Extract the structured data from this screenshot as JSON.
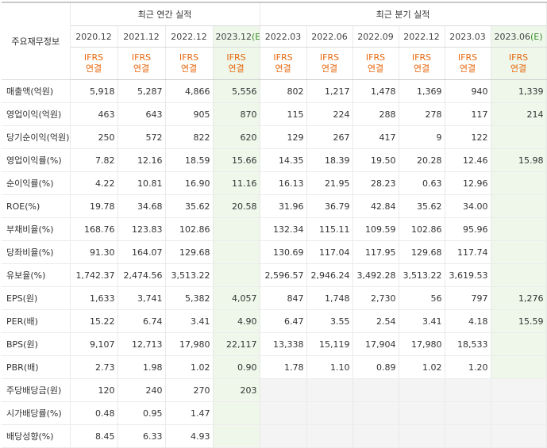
{
  "header": {
    "corner_label": "주요재무정보",
    "annual_group": "최근 연간 실적",
    "quarterly_group": "최근 분기 실적",
    "periods": [
      {
        "label": "2020.12",
        "est": false
      },
      {
        "label": "2021.12",
        "est": false
      },
      {
        "label": "2022.12",
        "est": false
      },
      {
        "label": "2023.12",
        "est": true,
        "est_mark": "(E)"
      },
      {
        "label": "2022.03",
        "est": false
      },
      {
        "label": "2022.06",
        "est": false
      },
      {
        "label": "2022.09",
        "est": false
      },
      {
        "label": "2022.12",
        "est": false
      },
      {
        "label": "2023.03",
        "est": false
      },
      {
        "label": "2023.06",
        "est": true,
        "est_mark": "(E)"
      }
    ],
    "ifrs_line1": "IFRS",
    "ifrs_line2": "연결"
  },
  "rows": [
    {
      "label": "매출액(억원)",
      "group_start": false,
      "values": [
        "5,918",
        "5,287",
        "4,866",
        "5,556",
        "802",
        "1,217",
        "1,478",
        "1,369",
        "940",
        "1,339"
      ]
    },
    {
      "label": "영업이익(억원)",
      "group_start": false,
      "values": [
        "463",
        "643",
        "905",
        "870",
        "115",
        "224",
        "288",
        "278",
        "117",
        "214"
      ]
    },
    {
      "label": "당기순이익(억원)",
      "group_start": false,
      "values": [
        "250",
        "572",
        "822",
        "620",
        "129",
        "267",
        "417",
        "9",
        "122",
        ""
      ]
    },
    {
      "label": "영업이익률(%)",
      "group_start": true,
      "values": [
        "7.82",
        "12.16",
        "18.59",
        "15.66",
        "14.35",
        "18.39",
        "19.50",
        "20.28",
        "12.46",
        "15.98"
      ]
    },
    {
      "label": "순이익률(%)",
      "group_start": false,
      "values": [
        "4.22",
        "10.81",
        "16.90",
        "11.16",
        "16.13",
        "21.95",
        "28.23",
        "0.63",
        "12.96",
        ""
      ]
    },
    {
      "label": "ROE(%)",
      "group_start": false,
      "values": [
        "19.78",
        "34.68",
        "35.62",
        "20.58",
        "31.96",
        "36.79",
        "42.84",
        "35.62",
        "34.00",
        ""
      ]
    },
    {
      "label": "부채비율(%)",
      "group_start": true,
      "values": [
        "168.76",
        "123.83",
        "102.86",
        "",
        "132.34",
        "115.11",
        "109.59",
        "102.86",
        "95.96",
        ""
      ]
    },
    {
      "label": "당좌비율(%)",
      "group_start": false,
      "values": [
        "91.30",
        "164.07",
        "129.68",
        "",
        "130.69",
        "117.04",
        "117.95",
        "129.68",
        "117.74",
        ""
      ]
    },
    {
      "label": "유보율(%)",
      "group_start": false,
      "values": [
        "1,742.37",
        "2,474.56",
        "3,513.22",
        "",
        "2,596.57",
        "2,946.24",
        "3,492.28",
        "3,513.22",
        "3,619.53",
        ""
      ]
    },
    {
      "label": "EPS(원)",
      "group_start": true,
      "values": [
        "1,633",
        "3,741",
        "5,382",
        "4,057",
        "847",
        "1,748",
        "2,730",
        "56",
        "797",
        "1,276"
      ]
    },
    {
      "label": "PER(배)",
      "group_start": false,
      "values": [
        "15.22",
        "6.74",
        "3.41",
        "4.90",
        "6.47",
        "3.55",
        "2.54",
        "3.41",
        "4.18",
        "15.59"
      ]
    },
    {
      "label": "BPS(원)",
      "group_start": false,
      "values": [
        "9,107",
        "12,713",
        "17,980",
        "22,117",
        "13,338",
        "15,119",
        "17,904",
        "17,980",
        "18,533",
        ""
      ]
    },
    {
      "label": "PBR(배)",
      "group_start": false,
      "values": [
        "2.73",
        "1.98",
        "1.02",
        "0.90",
        "1.78",
        "1.10",
        "0.89",
        "1.02",
        "1.20",
        ""
      ]
    },
    {
      "label": "주당배당금(원)",
      "group_start": true,
      "values": [
        "120",
        "240",
        "270",
        "203",
        "",
        "",
        "",
        "",
        "",
        ""
      ]
    },
    {
      "label": "시가배당률(%)",
      "group_start": false,
      "values": [
        "0.48",
        "0.95",
        "1.47",
        "",
        "",
        "",
        "",
        "",
        "",
        ""
      ]
    },
    {
      "label": "배당성향(%)",
      "group_start": false,
      "values": [
        "8.45",
        "6.33",
        "4.93",
        "",
        "",
        "",
        "",
        "",
        "",
        ""
      ]
    }
  ]
}
